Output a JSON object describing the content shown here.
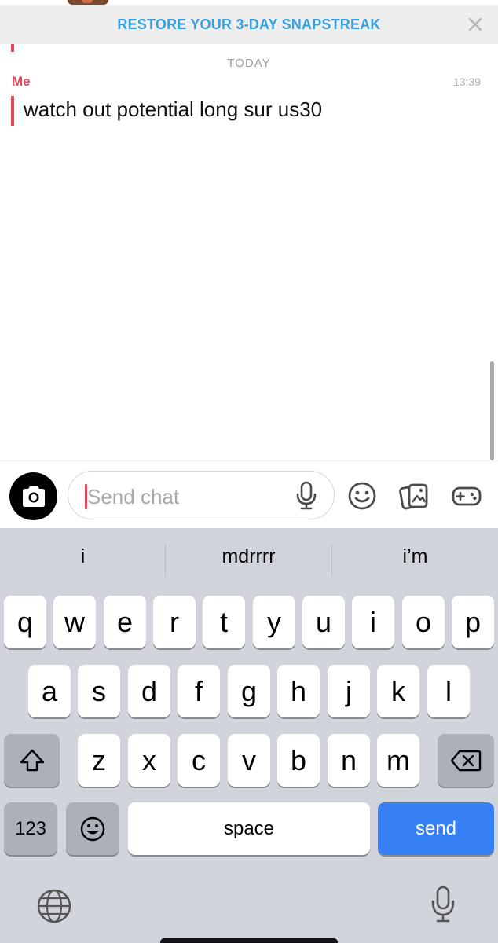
{
  "banner": {
    "text": "RESTORE YOUR 3-DAY SNAPSTREAK"
  },
  "chat": {
    "day_label": "TODAY",
    "sender": "Me",
    "time": "13:39",
    "message": "watch out potential long sur us30"
  },
  "input": {
    "placeholder": "Send chat"
  },
  "keyboard": {
    "suggestions": [
      "i",
      "mdrrrr",
      "i’m"
    ],
    "row1": [
      "q",
      "w",
      "e",
      "r",
      "t",
      "y",
      "u",
      "i",
      "o",
      "p"
    ],
    "row2": [
      "a",
      "s",
      "d",
      "f",
      "g",
      "h",
      "j",
      "k",
      "l"
    ],
    "row3": [
      "z",
      "x",
      "c",
      "v",
      "b",
      "n",
      "m"
    ],
    "numbers_label": "123",
    "space_label": "space",
    "send_label": "send"
  },
  "colors": {
    "accent": "#e0475b",
    "banner_text": "#3aa0dc",
    "send_key": "#3680f4"
  }
}
